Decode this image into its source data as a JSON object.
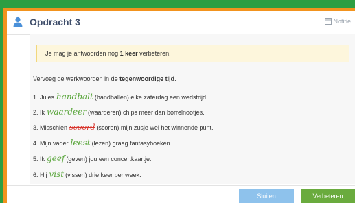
{
  "header": {
    "title": "Opdracht 3",
    "note_label": "Notitie"
  },
  "notice": {
    "prefix": "Je mag je antwoorden nog ",
    "bold": "1 keer",
    "suffix": " verbeteren."
  },
  "instruction": {
    "prefix": "Vervoeg de werkwoorden in de ",
    "bold": "tegenwoordige tijd",
    "suffix": "."
  },
  "items": [
    {
      "number": "1.",
      "before": "Jules",
      "answer": "handbalt",
      "after": "(handballen) elke zaterdag een wedstrijd.",
      "status": "correct"
    },
    {
      "number": "2.",
      "before": "Ik",
      "answer": "waardeer",
      "after": "(waarderen) chips meer dan borrelnootjes.",
      "status": "correct"
    },
    {
      "number": "3.",
      "before": "Misschien",
      "answer": "scoord",
      "after": "(scoren) mijn zusje wel het winnende punt.",
      "status": "wrong"
    },
    {
      "number": "4.",
      "before": "Mijn vader",
      "answer": "leest",
      "after": "(lezen) graag fantasyboeken.",
      "status": "correct"
    },
    {
      "number": "5.",
      "before": "Ik",
      "answer": "geef",
      "after": "(geven) jou een concertkaartje.",
      "status": "correct"
    },
    {
      "number": "6.",
      "before": "Hij",
      "answer": "vist",
      "after": "(vissen) drie keer per week.",
      "status": "correct"
    }
  ],
  "footer": {
    "close_label": "Sluiten",
    "improve_label": "Verbeteren"
  },
  "colors": {
    "correct": "#5aa63c",
    "wrong": "#d8342c",
    "close_button": "#8ec2ec",
    "improve_button": "#6aab3e"
  }
}
